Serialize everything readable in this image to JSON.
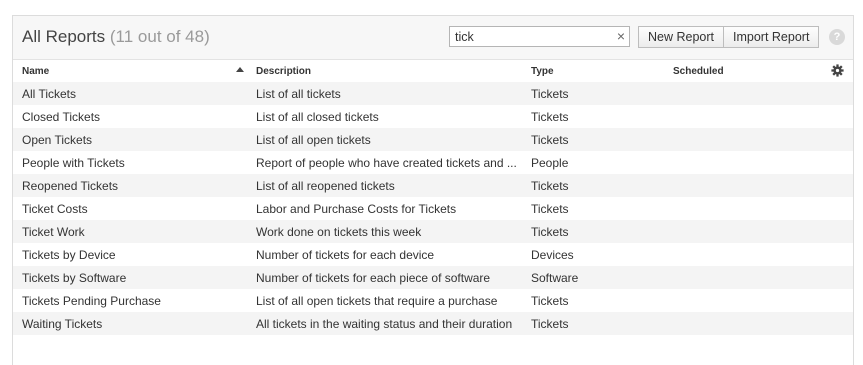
{
  "header": {
    "title": "All Reports",
    "count": "(11 out of 48)"
  },
  "search": {
    "value": "tick",
    "clear_label": "×"
  },
  "buttons": {
    "new_report": "New Report",
    "import_report": "Import Report",
    "help": "?"
  },
  "columns": {
    "name": "Name",
    "description": "Description",
    "type": "Type",
    "scheduled": "Scheduled"
  },
  "rows": [
    {
      "name": "All Tickets",
      "description": "List of all tickets",
      "type": "Tickets",
      "scheduled": ""
    },
    {
      "name": "Closed Tickets",
      "description": "List of all closed tickets",
      "type": "Tickets",
      "scheduled": ""
    },
    {
      "name": "Open Tickets",
      "description": "List of all open tickets",
      "type": "Tickets",
      "scheduled": ""
    },
    {
      "name": "People with Tickets",
      "description": "Report of people who have created tickets and ...",
      "type": "People",
      "scheduled": ""
    },
    {
      "name": "Reopened Tickets",
      "description": "List of all reopened tickets",
      "type": "Tickets",
      "scheduled": ""
    },
    {
      "name": "Ticket Costs",
      "description": "Labor and Purchase Costs for Tickets",
      "type": "Tickets",
      "scheduled": ""
    },
    {
      "name": "Ticket Work",
      "description": "Work done on tickets this week",
      "type": "Tickets",
      "scheduled": ""
    },
    {
      "name": "Tickets by Device",
      "description": "Number of tickets for each device",
      "type": "Devices",
      "scheduled": ""
    },
    {
      "name": "Tickets by Software",
      "description": "Number of tickets for each piece of software",
      "type": "Software",
      "scheduled": ""
    },
    {
      "name": "Tickets Pending Purchase",
      "description": "List of all open tickets that require a purchase",
      "type": "Tickets",
      "scheduled": ""
    },
    {
      "name": "Waiting Tickets",
      "description": "All tickets in the waiting status and their duration",
      "type": "Tickets",
      "scheduled": ""
    }
  ]
}
